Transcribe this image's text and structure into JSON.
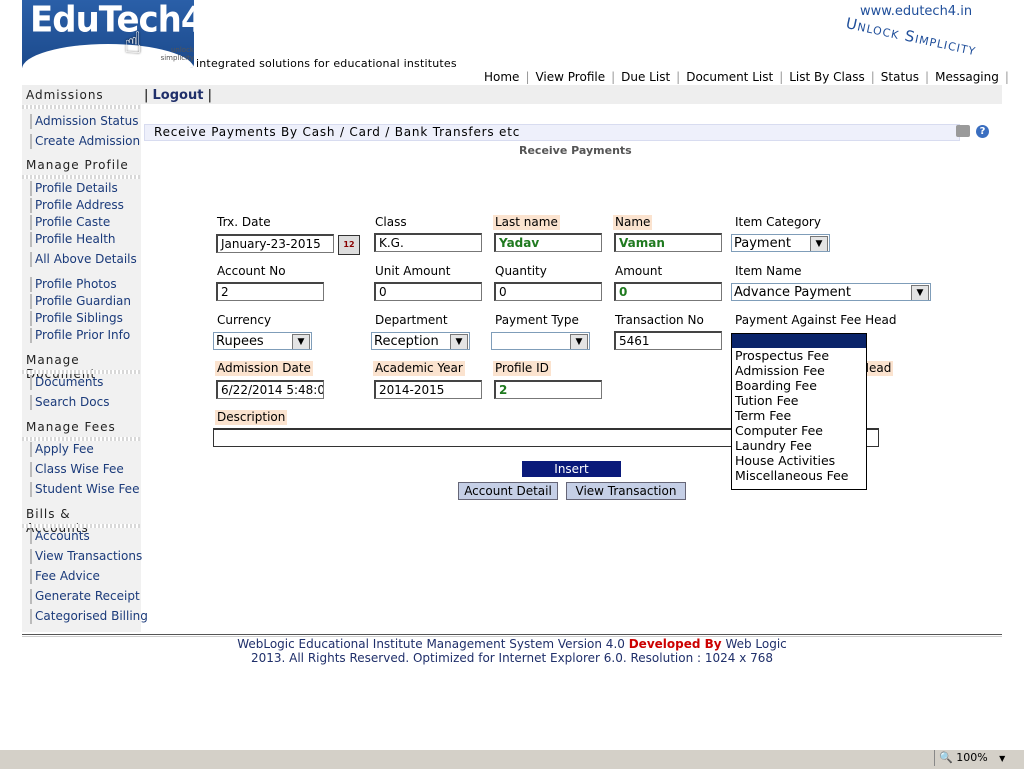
{
  "header": {
    "logo_text": "EduTech4",
    "logo_sub": "unlock simplicity",
    "tagline": "integrated solutions for educational institutes",
    "site_url": "www.edutech4.in",
    "slogan": "Unlock Simplicity"
  },
  "topnav": [
    "Home",
    "View Profile",
    "Due List",
    "Document List",
    "List By Class",
    "Status",
    "Messaging"
  ],
  "sidebar": {
    "sections": [
      {
        "title": "Admissions",
        "items": [
          "Admission Status",
          "Create Admission"
        ]
      },
      {
        "title": "Manage Profile",
        "items": [
          "Profile Details",
          "Profile Address",
          "Profile Caste",
          "Profile Health",
          "All Above Details",
          "Profile Photos",
          "Profile Guardian",
          "Profile Siblings",
          "Profile Prior Info"
        ]
      },
      {
        "title": "Manage Document",
        "items": [
          "Documents",
          "Search Docs"
        ]
      },
      {
        "title": "Manage Fees",
        "items": [
          "Apply Fee",
          "Class Wise Fee",
          "Student Wise Fee"
        ]
      },
      {
        "title": "Bills & Accounts",
        "items": [
          "Accounts",
          "View Transactions",
          "Fee Advice",
          "Generate Receipt",
          "Categorised Billing"
        ]
      }
    ]
  },
  "logout": "Logout",
  "form": {
    "title": "Receive Payments By Cash / Card / Bank Transfers etc",
    "subtitle": "Receive Payments",
    "labels": {
      "trx_date": "Trx. Date",
      "class": "Class",
      "last_name": "Last name",
      "name": "Name",
      "item_category": "Item Category",
      "account_no": "Account No",
      "unit_amount": "Unit Amount",
      "quantity": "Quantity",
      "amount": "Amount",
      "item_name": "Item Name",
      "currency": "Currency",
      "department": "Department",
      "payment_type": "Payment Type",
      "transaction_no": "Transaction No",
      "payment_against": "Payment Against Fee Head",
      "admission_date": "Admission Date",
      "academic_year": "Academic Year",
      "profile_id": "Profile ID",
      "hidden_head": "Head",
      "description": "Description"
    },
    "values": {
      "trx_date": "January-23-2015",
      "class": "K.G.",
      "last_name": "Yadav",
      "name": "Vaman",
      "item_category": "Payment",
      "account_no": "2",
      "unit_amount": "0",
      "quantity": "0",
      "amount": "0",
      "item_name": "Advance Payment",
      "currency": "Rupees",
      "department": "Reception",
      "payment_type": "",
      "transaction_no": "5461",
      "admission_date": "6/22/2014 5:48:0",
      "academic_year": "2014-2015",
      "profile_id": "2",
      "description": ""
    },
    "buttons": {
      "insert": "Insert",
      "account_detail": "Account Detail",
      "view_transaction": "View Transaction"
    },
    "fee_head_options": [
      "Prospectus Fee",
      "Admission Fee",
      "Boarding Fee",
      "Tution Fee",
      "Term Fee",
      "Computer Fee",
      "Laundry Fee",
      "House Activities",
      "Miscellaneous Fee"
    ]
  },
  "footer": {
    "line1_a": "WebLogic Educational Institute Management System Version 4.0",
    "line1_red": "Developed By",
    "line1_b": "Web Logic",
    "line2": "2013. All Rights Reserved. Optimized for Internet Explorer 6.0.  Resolution : 1024 x 768"
  },
  "statusbar": {
    "zoom": "100%"
  },
  "colors": {
    "accent": "#0a1a7a",
    "label_highlight": "#fbe3cf",
    "link": "#1a3a7a",
    "red": "#cc0000"
  }
}
